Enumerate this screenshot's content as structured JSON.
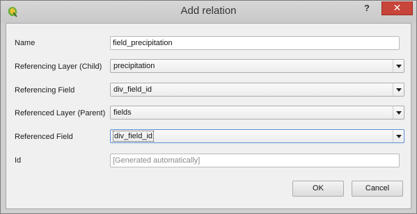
{
  "window": {
    "title": "Add relation",
    "help_label": "?",
    "close_label": "✕"
  },
  "form": {
    "name": {
      "label": "Name",
      "value": "field_precipitation"
    },
    "referencing_layer": {
      "label": "Referencing Layer (Child)",
      "value": "precipitation"
    },
    "referencing_field": {
      "label": "Referencing Field",
      "value": "div_field_id"
    },
    "referenced_layer": {
      "label": "Referenced Layer (Parent)",
      "value": "fields"
    },
    "referenced_field": {
      "label": "Referenced Field",
      "value": "div_field_id"
    },
    "id": {
      "label": "Id",
      "value": "",
      "placeholder": "[Generated automatically]"
    }
  },
  "buttons": {
    "ok": "OK",
    "cancel": "Cancel"
  },
  "icons": {
    "app": "qgis-icon",
    "combo_arrow": "chevron-down-icon"
  }
}
